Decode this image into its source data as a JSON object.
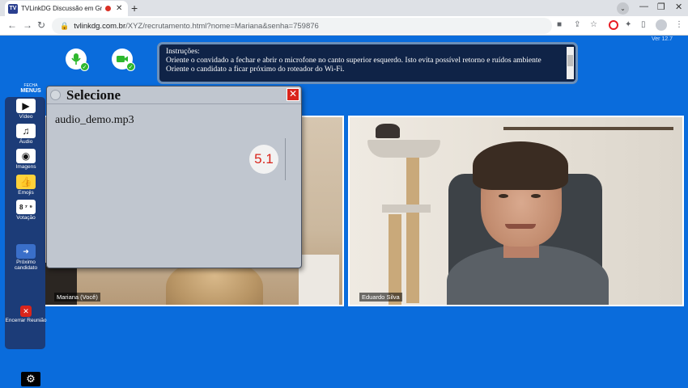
{
  "browser": {
    "tab_title": "TVLinkDG Discussão em Gru",
    "tab_favicon": "TV",
    "new_tab": "+",
    "url_host": "tvlinkdg.com.br",
    "url_path": "/XYZ/recrutamento.html?nome=Mariana&senha=759876"
  },
  "app": {
    "version": "Ver 12.7",
    "instructions": {
      "heading": "Instruções:",
      "lines": [
        "Oriente o convidado a fechar e abrir o microfone no canto superior esquerdo. Isto evita possível retorno e ruídos ambiente",
        "Oriente o candidato a ficar próximo do roteador do Wi-Fi."
      ]
    },
    "menu_toggle": {
      "small": "FECHA",
      "big": "MENUS"
    },
    "sidebar": {
      "video": "Vídeo",
      "audio": "Áudio",
      "images": "Imagens",
      "emojis": "Emojis",
      "voting": "Votação",
      "next_candidate": "Próximo candidato",
      "end_meeting": "Encerrar Reunião"
    },
    "videos": {
      "left_label": "Mariana (Você)",
      "right_label": "Eduardo Silva"
    },
    "dialog": {
      "title": "Selecione",
      "close": "✕",
      "file": "audio_demo.mp3",
      "badge": "5.1"
    }
  }
}
